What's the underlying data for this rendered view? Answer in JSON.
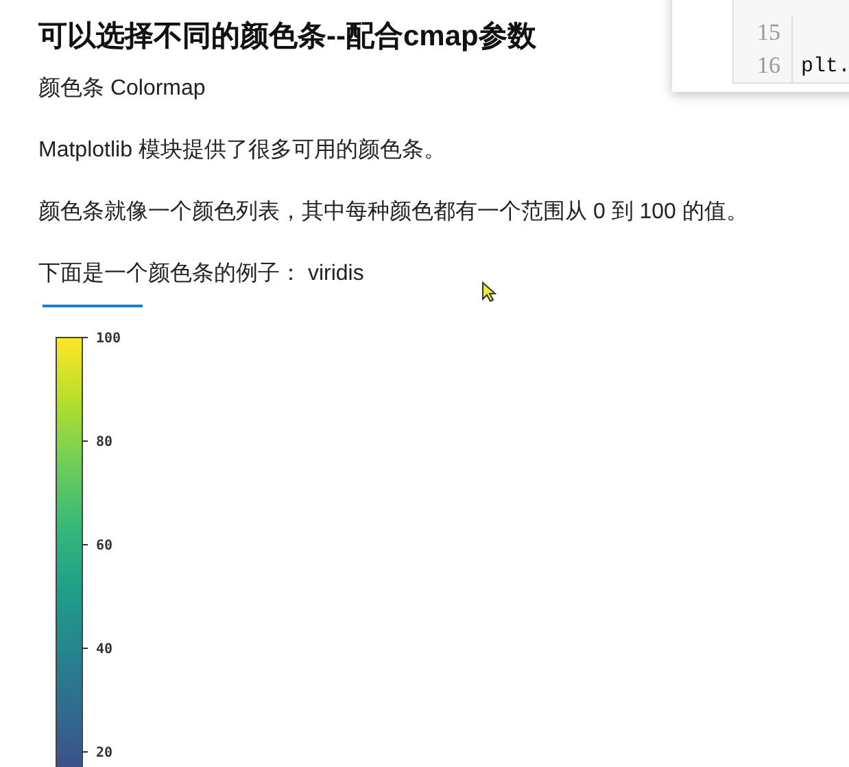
{
  "heading": "可以选择不同的颜色条--配合cmap参数",
  "paragraphs": [
    "颜色条 Colormap",
    "Matplotlib 模块提供了很多可用的颜色条。",
    "颜色条就像一个颜色列表，其中每种颜色都有一个范围从 0 到 100 的值。",
    "下面是一个颜色条的例子： viridis"
  ],
  "code_popup": {
    "lines": [
      {
        "number": "15"
      },
      {
        "number": "16",
        "code": "plt."
      }
    ]
  },
  "colorbar": {
    "ticks": [
      "100",
      "80",
      "60",
      "40",
      "20"
    ]
  }
}
